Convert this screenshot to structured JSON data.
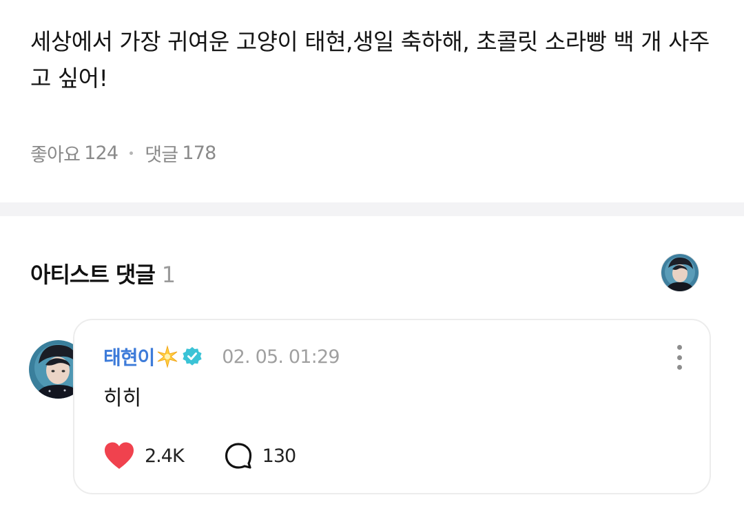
{
  "post": {
    "text": "세상에서 가장 귀여운 고양이 태현,생일 축하해, 초콜릿 소라빵 백 개 사주고 싶어!",
    "likes_label": "좋아요",
    "likes_count": "124",
    "comments_label": "댓글",
    "comments_count": "178"
  },
  "artist_comments": {
    "title": "아티스트 댓글",
    "count": "1"
  },
  "comment": {
    "author": "태현이",
    "timestamp": "02. 05. 01:29",
    "body": "히히",
    "likes": "2.4K",
    "replies": "130"
  },
  "colors": {
    "author": "#3d7bd9",
    "verified": "#3bc3d6",
    "heart": "#f0424e",
    "muted": "#8a8a8a",
    "divider": "#f3f3f5"
  },
  "icons": {
    "more": "more-vertical-icon",
    "heart": "heart-icon",
    "reply": "speech-bubble-icon",
    "verified": "verified-badge-icon",
    "sparkle": "sparkle-star-icon"
  }
}
